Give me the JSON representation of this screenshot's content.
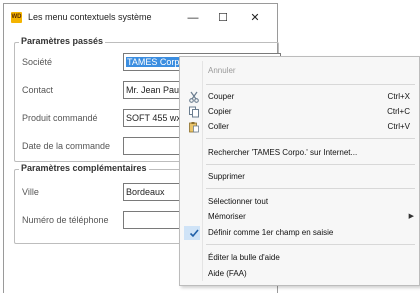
{
  "window": {
    "icon_text": "WD",
    "title": "Les menu contextuels système",
    "min": "—",
    "max": "☐",
    "close": "✕"
  },
  "group1": {
    "title": "Paramètres passés",
    "rows": [
      {
        "label": "Société",
        "value": "TAMES Corpo."
      },
      {
        "label": "Contact",
        "value": "Mr. Jean Paul L"
      },
      {
        "label": "Produit commandé",
        "value": "SOFT 455 wx"
      },
      {
        "label": "Date de la commande",
        "value": ""
      }
    ]
  },
  "group2": {
    "title": "Paramètres complémentaires",
    "rows": [
      {
        "label": "Ville",
        "value": "Bordeaux"
      },
      {
        "label": "Numéro de téléphone",
        "value": ""
      }
    ]
  },
  "menu": {
    "undo": "Annuler",
    "cut": "Couper",
    "cut_sc": "Ctrl+X",
    "copy": "Copier",
    "copy_sc": "Ctrl+C",
    "paste": "Coller",
    "paste_sc": "Ctrl+V",
    "search": "Rechercher 'TAMES Corpo.' sur Internet...",
    "delete": "Supprimer",
    "select_all": "Sélectionner tout",
    "remember": "Mémoriser",
    "set_first": "Définir comme 1er champ en saisie",
    "edit_tooltip": "Éditer la bulle d'aide",
    "help": "Aide (FAA)"
  }
}
